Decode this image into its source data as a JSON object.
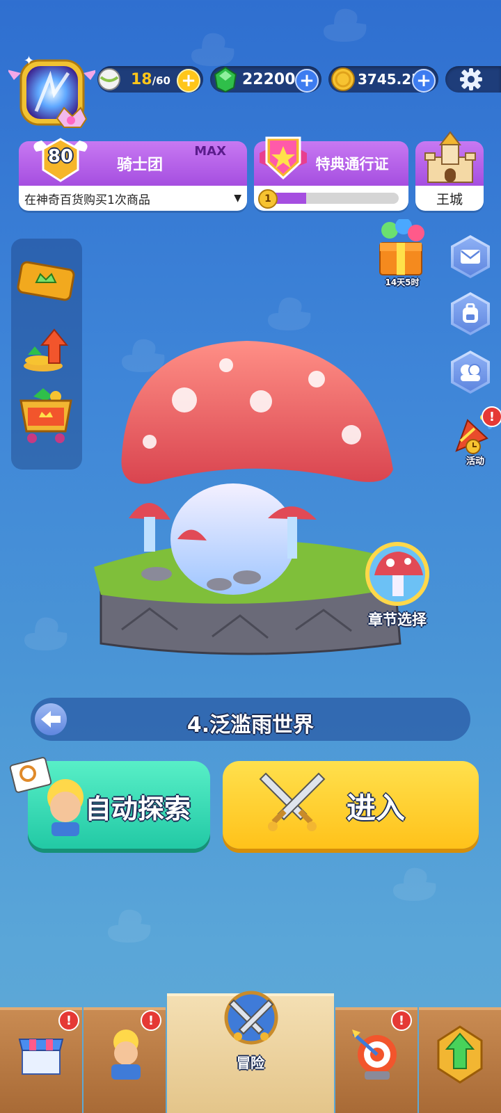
{
  "resources": {
    "energy": {
      "current": "18",
      "max": "/60"
    },
    "gems": "22200",
    "coins": "3745.2K"
  },
  "player": {
    "level": "80"
  },
  "knight_card": {
    "title": "骑士团",
    "tag": "MAX",
    "task": "在神奇百货购买1次商品"
  },
  "pass_card": {
    "title": "特典通行证",
    "level": "1",
    "progress": 0.3
  },
  "castle_card": {
    "label": "王城"
  },
  "gift": {
    "timer": "14天5时"
  },
  "event": {
    "label": "活动"
  },
  "chapter": {
    "select_label": "章节选择",
    "name": "4.泛滥雨世界"
  },
  "actions": {
    "auto_explore": "自动探索",
    "enter": "进入"
  },
  "bottom_nav": {
    "adventure": "冒险"
  },
  "colors": {
    "accent_yellow": "#ffc61a",
    "teal": "#2fd6b4",
    "purple": "#a54ee0",
    "alert_red": "#e53935"
  }
}
